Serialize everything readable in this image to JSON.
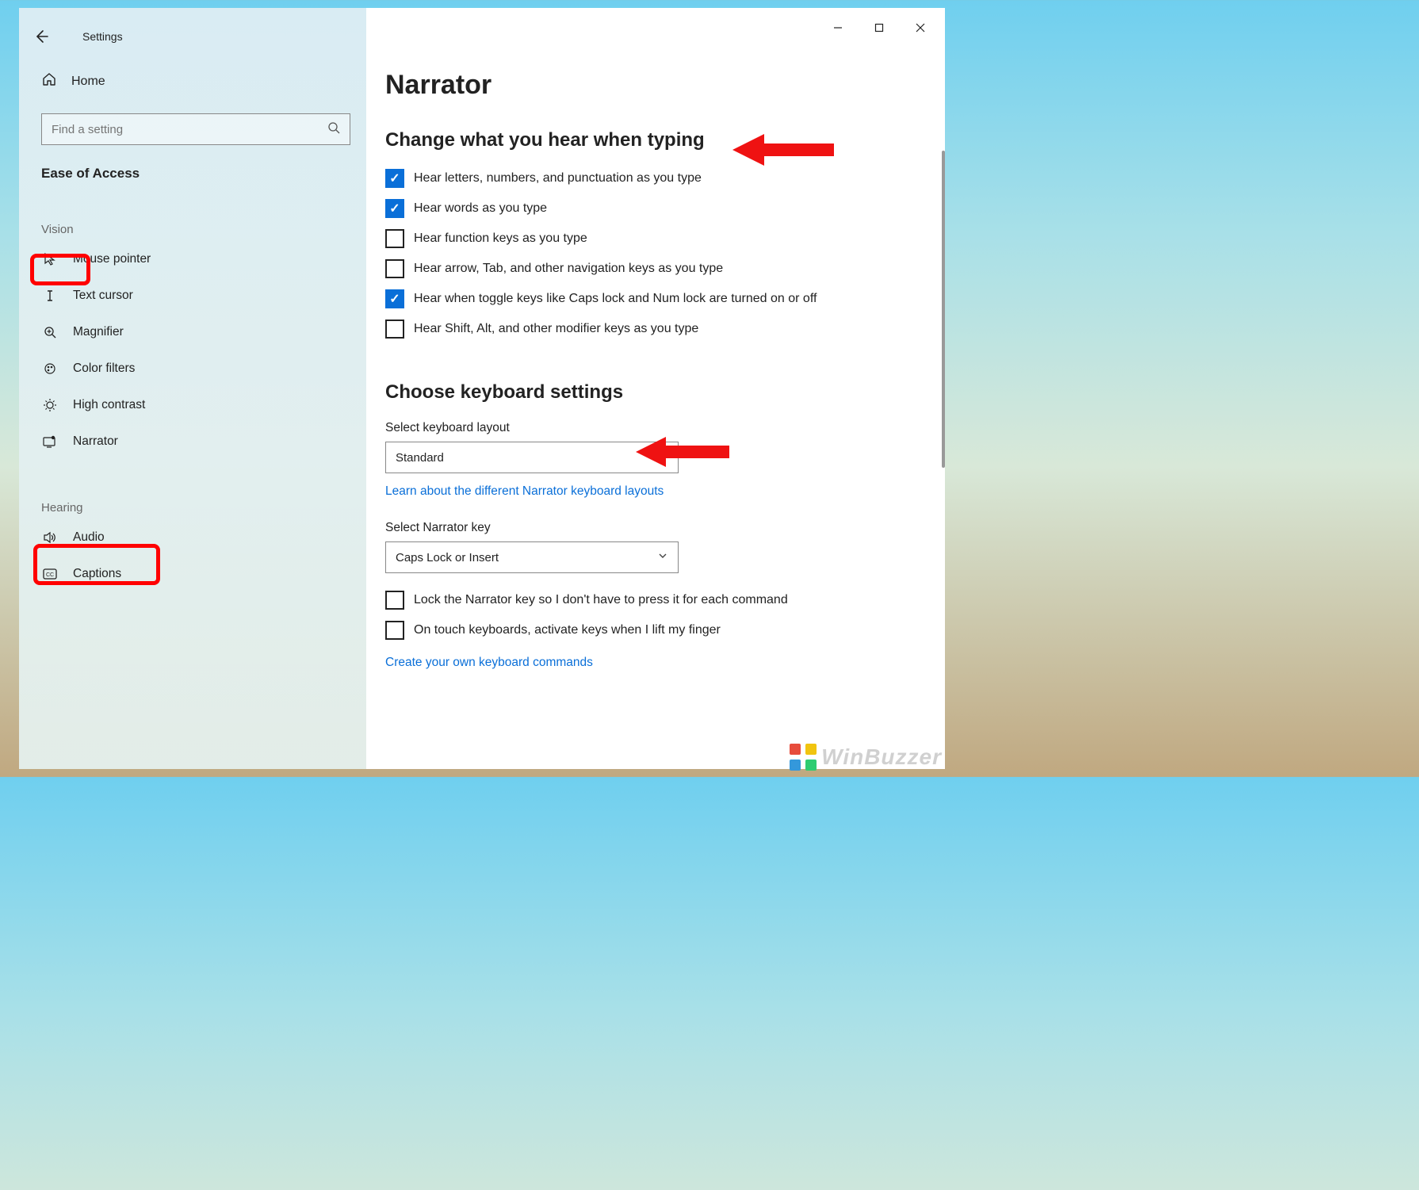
{
  "window": {
    "title": "Settings",
    "home_label": "Home",
    "search_placeholder": "Find a setting",
    "category": "Ease of Access"
  },
  "sidebar": {
    "groups": [
      {
        "label": "Vision",
        "items": [
          {
            "label": "Mouse pointer",
            "icon": "mouse-pointer-icon"
          },
          {
            "label": "Text cursor",
            "icon": "text-cursor-icon"
          },
          {
            "label": "Magnifier",
            "icon": "magnifier-icon"
          },
          {
            "label": "Color filters",
            "icon": "color-filters-icon"
          },
          {
            "label": "High contrast",
            "icon": "high-contrast-icon"
          },
          {
            "label": "Narrator",
            "icon": "narrator-icon"
          }
        ]
      },
      {
        "label": "Hearing",
        "items": [
          {
            "label": "Audio",
            "icon": "audio-icon"
          },
          {
            "label": "Captions",
            "icon": "captions-icon"
          }
        ]
      }
    ]
  },
  "page": {
    "title": "Narrator",
    "section1": {
      "title": "Change what you hear when typing",
      "checks": [
        {
          "checked": true,
          "label": "Hear letters, numbers, and punctuation as you type"
        },
        {
          "checked": true,
          "label": "Hear words as you type"
        },
        {
          "checked": false,
          "label": "Hear function keys as you type"
        },
        {
          "checked": false,
          "label": "Hear arrow, Tab, and other navigation keys as you type"
        },
        {
          "checked": true,
          "label": "Hear when toggle keys like Caps lock and Num lock are turned on or off"
        },
        {
          "checked": false,
          "label": "Hear Shift, Alt, and other modifier keys as you type"
        }
      ]
    },
    "section2": {
      "title": "Choose keyboard settings",
      "layout_label": "Select keyboard layout",
      "layout_value": "Standard",
      "layout_link": "Learn about the different Narrator keyboard layouts",
      "narrator_key_label": "Select Narrator key",
      "narrator_key_value": "Caps Lock or Insert",
      "checks": [
        {
          "checked": false,
          "label": "Lock the Narrator key so I don't have to press it for each command"
        },
        {
          "checked": false,
          "label": "On touch keyboards, activate keys when I lift my finger"
        }
      ],
      "commands_link": "Create your own keyboard commands"
    }
  },
  "watermark": "WinBuzzer"
}
